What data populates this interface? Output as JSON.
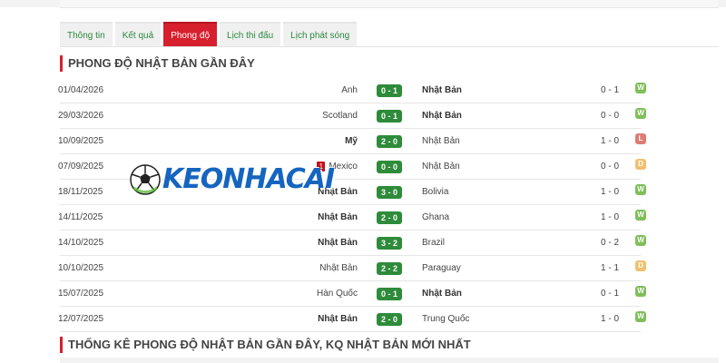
{
  "tabs": [
    {
      "label": "Thông tin"
    },
    {
      "label": "Kết quả"
    },
    {
      "label": "Phong độ",
      "active": true
    },
    {
      "label": "Lịch thi đấu"
    },
    {
      "label": "Lịch phát sóng"
    }
  ],
  "section1_title": "PHONG ĐỘ NHẬT BẢN GẦN ĐÂY",
  "matches": [
    {
      "date": "01/04/2026",
      "home": "Anh",
      "score": "0 - 1",
      "away": "Nhật Bản",
      "ht": "0 - 1",
      "result": "W",
      "winner": "away"
    },
    {
      "date": "29/03/2026",
      "home": "Scotland",
      "score": "0 - 1",
      "away": "Nhật Bản",
      "ht": "0 - 0",
      "result": "W",
      "winner": "away"
    },
    {
      "date": "10/09/2025",
      "home": "Mỹ",
      "score": "2 - 0",
      "away": "Nhật Bản",
      "ht": "1 - 0",
      "result": "L",
      "winner": "home"
    },
    {
      "date": "07/09/2025",
      "home": "Mexico",
      "home_red_card": "1",
      "score": "0 - 0",
      "away": "Nhật Bản",
      "ht": "0 - 0",
      "result": "D",
      "winner": ""
    },
    {
      "date": "18/11/2025",
      "home": "Nhật Bản",
      "score": "3 - 0",
      "away": "Bolivia",
      "ht": "1 - 0",
      "result": "W",
      "winner": "home"
    },
    {
      "date": "14/11/2025",
      "home": "Nhật Bản",
      "score": "2 - 0",
      "away": "Ghana",
      "ht": "1 - 0",
      "result": "W",
      "winner": "home"
    },
    {
      "date": "14/10/2025",
      "home": "Nhật Bản",
      "score": "3 - 2",
      "away": "Brazil",
      "ht": "0 - 2",
      "result": "W",
      "winner": "home"
    },
    {
      "date": "10/10/2025",
      "home": "Nhật Bản",
      "score": "2 - 2",
      "away": "Paraguay",
      "ht": "1 - 1",
      "result": "D",
      "winner": ""
    },
    {
      "date": "15/07/2025",
      "home": "Hàn Quốc",
      "score": "0 - 1",
      "away": "Nhật Bản",
      "ht": "0 - 1",
      "result": "W",
      "winner": "away"
    },
    {
      "date": "12/07/2025",
      "home": "Nhật Bản",
      "score": "2 - 0",
      "away": "Trung Quốc",
      "ht": "1 - 0",
      "result": "W",
      "winner": "home"
    }
  ],
  "section2_title": "THỐNG KÊ PHONG ĐỘ NHẬT BẢN GẦN ĐÂY, KQ NHẬT BẢN MỚI NHẤT",
  "watermark_text": "KEONHACAI",
  "colors": {
    "accent": "#d6202e",
    "score_bg": "#2e8b3a",
    "win": "#7fbf5a",
    "loss": "#e07b72",
    "draw": "#f0c070",
    "watermark": "#1565c0"
  }
}
